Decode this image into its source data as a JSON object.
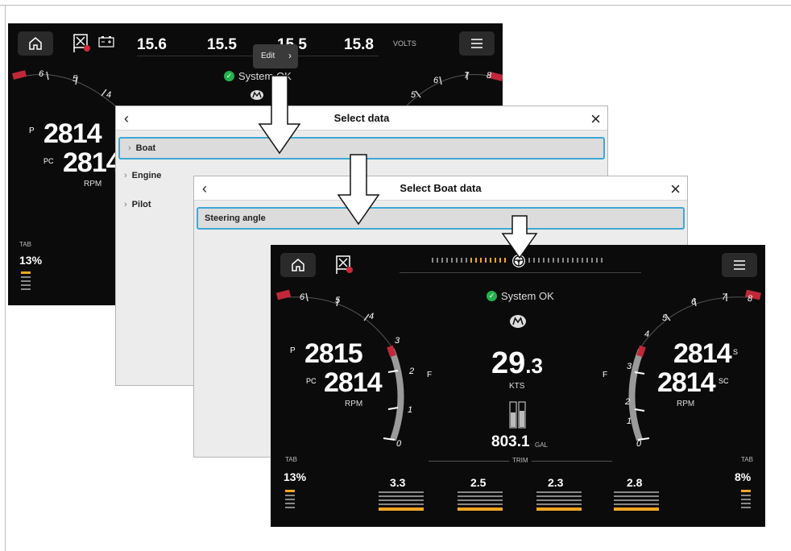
{
  "screen1": {
    "volts": [
      "15.6",
      "15.5",
      "15.5",
      "15.8"
    ],
    "volts_unit": "VOLTS",
    "edit_label": "Edit",
    "status": "System OK",
    "rpm_port": "2814",
    "rpm_port_center": "2814",
    "port_prefix": "P",
    "port_center_prefix": "PC",
    "rpm_unit": "RPM",
    "tab_label": "TAB",
    "tab_value": "13%",
    "gauge_ticks_left": [
      "6",
      "5",
      "4"
    ],
    "gauge_ticks_right": [
      "5",
      "6",
      "7",
      "8"
    ]
  },
  "dialog1": {
    "title": "Select data",
    "items": [
      "Boat",
      "Engine",
      "Pilot"
    ]
  },
  "dialog2": {
    "title": "Select Boat data",
    "items": [
      "Steering angle"
    ]
  },
  "screen3": {
    "status": "System OK",
    "port_prefix": "P",
    "port_center_prefix": "PC",
    "starboard_prefix": "S",
    "starboard_center_prefix": "SC",
    "rpm_port": "2815",
    "rpm_port_center": "2814",
    "rpm_starboard": "2814",
    "rpm_starboard_center": "2814",
    "rpm_unit": "RPM",
    "speed_int": "29",
    "speed_dec": ".3",
    "speed_unit": "KTS",
    "fuel_value": "803.1",
    "fuel_unit": "GAL",
    "trim_label": "TRIM",
    "trim_values": [
      "3.3",
      "2.5",
      "2.3",
      "2.8"
    ],
    "tab_left_label": "TAB",
    "tab_left_value": "13%",
    "tab_right_label": "TAB",
    "tab_right_value": "8%",
    "fuel_letter": "F",
    "left_gauge_ticks": [
      "6",
      "5",
      "4",
      "3",
      "2",
      "1",
      "0"
    ],
    "right_gauge_ticks": [
      "5",
      "6",
      "7",
      "8",
      "4",
      "3",
      "2",
      "1",
      "0"
    ]
  },
  "colors": {
    "accent_orange": "#f5a623",
    "selection_blue": "#3fa7d6",
    "ok_green": "#22b24c",
    "redline": "#c0283a"
  },
  "icons": [
    "home-icon",
    "fault-flag-icon",
    "battery-icon",
    "menu-icon",
    "check-circle-icon",
    "mercury-logo-icon",
    "steering-wheel-icon",
    "close-icon",
    "back-icon",
    "chevron-right-icon",
    "fuel-tank-icon",
    "down-arrow-icon"
  ]
}
